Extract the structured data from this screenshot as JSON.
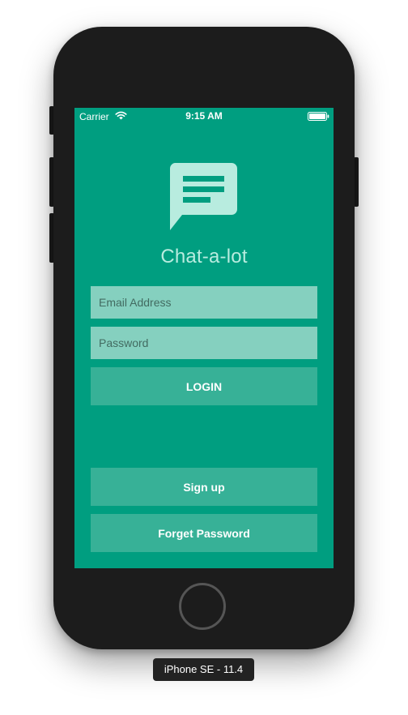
{
  "status_bar": {
    "carrier": "Carrier",
    "time": "9:15 AM",
    "wifi_icon": "wifi-icon",
    "battery_icon": "battery-icon"
  },
  "app": {
    "logo_icon": "chat-bubble-icon",
    "title": "Chat-a-lot"
  },
  "form": {
    "email_placeholder": "Email Address",
    "email_value": "",
    "password_placeholder": "Password",
    "password_value": "",
    "login_label": "LOGIN"
  },
  "footer": {
    "signup_label": "Sign up",
    "forget_label": "Forget Password"
  },
  "device": {
    "label": "iPhone SE - 11.4"
  },
  "colors": {
    "screen_background": "#009e80",
    "input_background": "#85d0bf",
    "button_background": "#37b197",
    "title_color": "#b8ecdf",
    "logo_color": "#b8ecdf"
  }
}
